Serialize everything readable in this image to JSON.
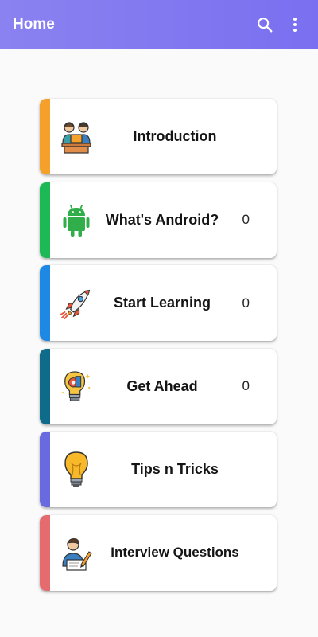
{
  "app_bar": {
    "title": "Home",
    "background": "#7a6ff0",
    "actions": [
      {
        "icon": "search-icon"
      },
      {
        "icon": "more-vert-icon"
      }
    ]
  },
  "cards": [
    {
      "label": "Introduction",
      "count": "",
      "accent": "#f5a02a",
      "icon": "people-laptop-icon"
    },
    {
      "label": "What's Android?",
      "count": "0",
      "accent": "#1db954",
      "icon": "android-icon"
    },
    {
      "label": "Start Learning",
      "count": "0",
      "accent": "#1e88e5",
      "icon": "rocket-icon"
    },
    {
      "label": "Get Ahead",
      "count": "0",
      "accent": "#0f6b8a",
      "icon": "idea-bulb-icon"
    },
    {
      "label": "Tips n Tricks",
      "count": "",
      "accent": "#6a6ae0",
      "icon": "lightbulb-icon"
    },
    {
      "label": "Interview Questions",
      "count": "",
      "accent": "#e56b6f",
      "icon": "interview-person-icon"
    }
  ]
}
